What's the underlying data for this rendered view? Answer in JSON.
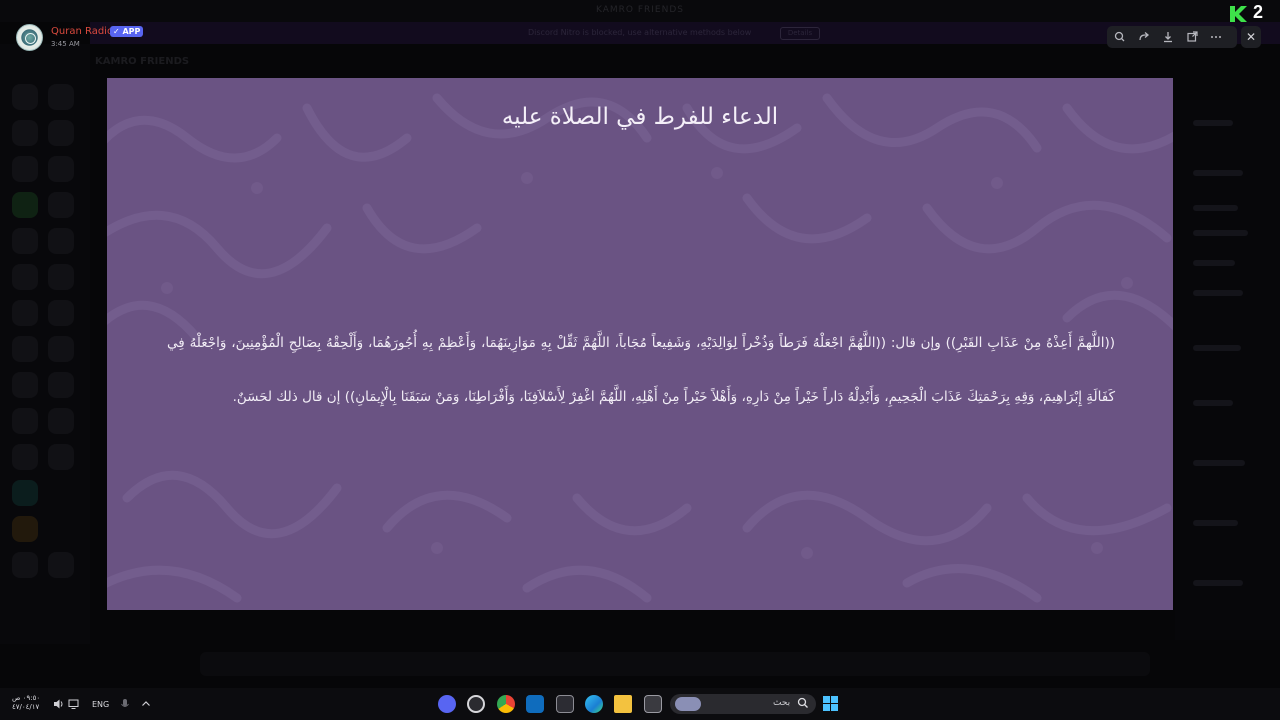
{
  "background_app": {
    "window_title": "KAMRO FRIENDS",
    "banner_text": "Discord Nitro is blocked, use alternative methods below",
    "banner_button": "Details",
    "channel_header": "KAMRO FRIENDS"
  },
  "viewer": {
    "author": "Quran Radio",
    "badge": "✓ APP",
    "timestamp": "3:45 AM",
    "actions": [
      "zoom-icon",
      "forward-icon",
      "download-icon",
      "open-external-icon",
      "more-icon"
    ],
    "close_label": "✕"
  },
  "brand": {
    "number": "2",
    "accent": "#3ee14a"
  },
  "slide": {
    "background": "#6a5383",
    "title": "الدعاء للفرط في الصلاة عليه",
    "body": "((اللَّهمَّ أَعِذْهُ مِنْ عَذَابِ القَبْرِ)) وإن قال: ((اللَّهُمَّ اجْعَلْهُ فَرَطاً وَذُخْراً لِوَالِدَيْهِ، وَشَفِيعاً مُجَاباً، اللَّهُمَّ ثَقِّلْ بِهِ مَوَازِينَهُمَا، وَأَعْظِمْ بِهِ أُجُورَهُمَا، وَأَلْحِقْهُ بِصَالِحِ الْمُؤْمِنِينَ، وَاجْعَلْهُ فِي كَفَالَةِ إِبْرَاهِيمَ، وَقِهِ بِرَحْمَتِكَ عَذَابَ الْجَحِيمِ، وَأَبْدِلْهُ دَاراً خَيْراً مِنْ دَارِهِ، وَأَهْلاً خَيْراً مِنْ أَهْلِهِ، اللَّهُمَّ اغْفِرْ لِأَسْلاَفِنَا، وَأَفْرَاطِنَا، وَمَنْ سَبَقَنَا بِالْإِيمَانِ)) إن قال ذلك لحَسَنٌ."
  },
  "taskbar": {
    "time": "٠٩:٥٠ ص",
    "date": "٤٧/٠٤/١٧",
    "language": "ENG",
    "search_placeholder": "بحث",
    "apps": [
      "discord-icon",
      "app-icon",
      "chrome-icon",
      "outlook-icon",
      "store-icon",
      "edge-icon",
      "file-explorer-icon",
      "app-window-icon"
    ]
  }
}
